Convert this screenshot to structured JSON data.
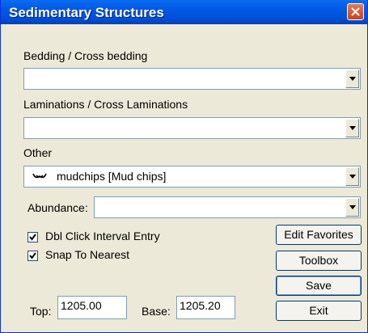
{
  "window": {
    "title": "Sedimentary Structures"
  },
  "bedding": {
    "label": "Bedding / Cross bedding",
    "value": ""
  },
  "laminations": {
    "label": "Laminations / Cross Laminations",
    "value": ""
  },
  "other": {
    "label": "Other",
    "value": "mudchips [Mud chips]",
    "icon": "mudchips-symbol-icon"
  },
  "abundance": {
    "label": "Abundance:",
    "value": ""
  },
  "options": {
    "dbl_click": {
      "label": "Dbl Click Interval Entry",
      "checked": true
    },
    "snap": {
      "label": "Snap To Nearest",
      "checked": true
    }
  },
  "buttons": {
    "edit_favorites": "Edit Favorites",
    "toolbox": "Toolbox",
    "save": "Save",
    "exit": "Exit"
  },
  "interval": {
    "top_label": "Top:",
    "top_value": "1205.00",
    "base_label": "Base:",
    "base_value": "1205.20"
  },
  "colors": {
    "titlebar": "#0058e6",
    "close": "#d8582e",
    "dialog_bg": "#ece9d8"
  }
}
